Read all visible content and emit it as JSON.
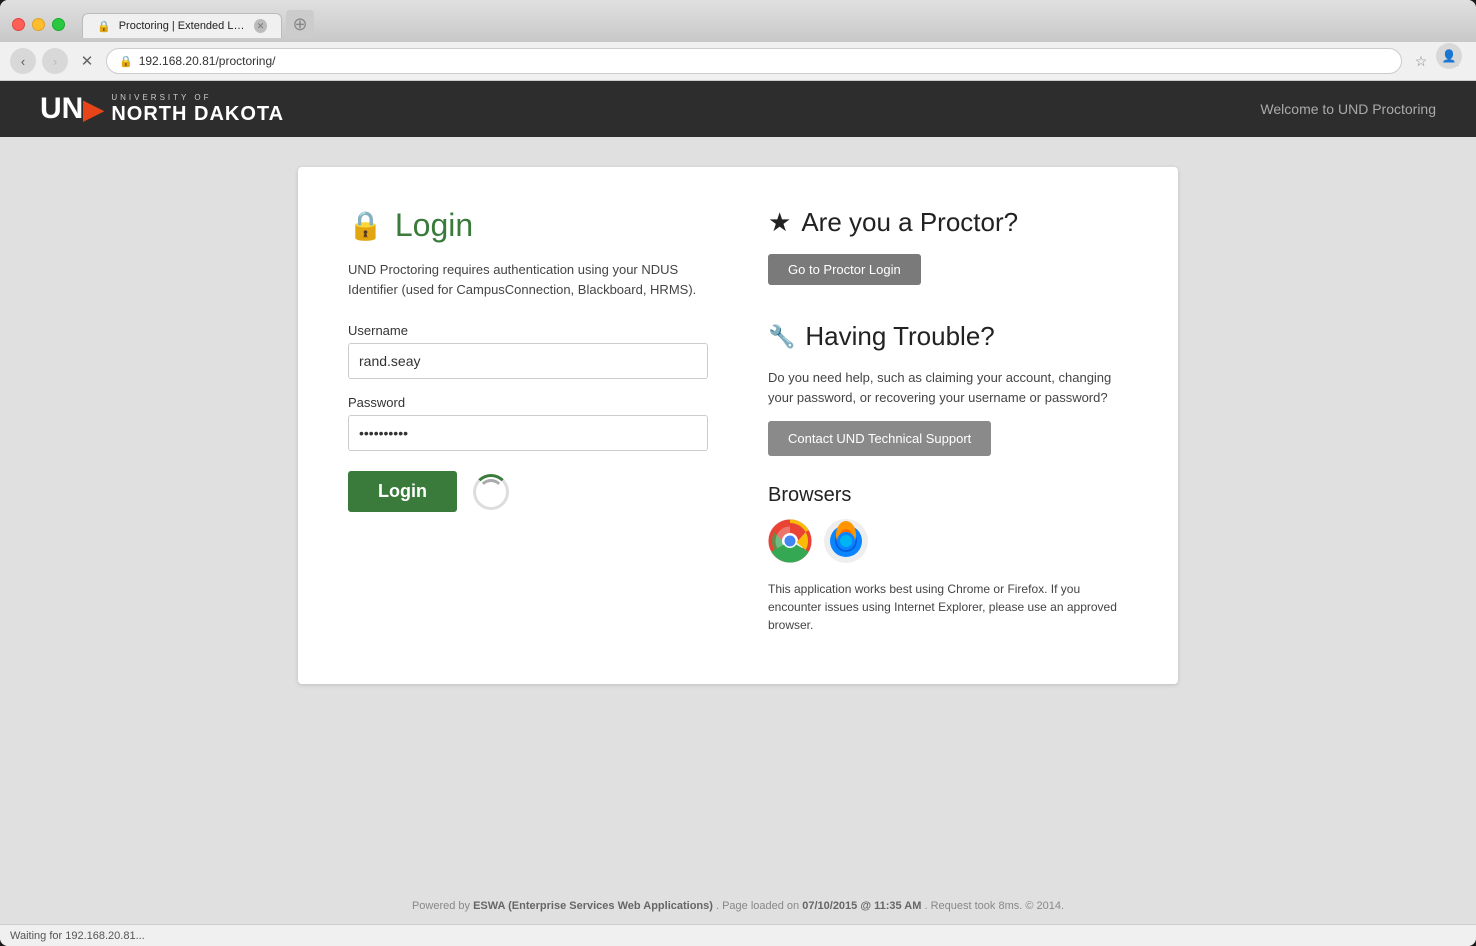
{
  "browser": {
    "tab_title": "Proctoring | Extended Lea…",
    "url": "192.168.20.81/proctoring/",
    "profile_icon": "👤"
  },
  "header": {
    "logo_university_of": "UNIVERSITY OF",
    "logo_north_dakota": "NORTH DAKOTA",
    "welcome_text": "Welcome to UND Proctoring"
  },
  "login": {
    "heading": "Login",
    "description": "UND Proctoring requires authentication using your NDUS Identifier (used for CampusConnection, Blackboard, HRMS).",
    "username_label": "Username",
    "username_value": "rand.seay",
    "password_label": "Password",
    "password_value": "••••••••••",
    "login_button": "Login"
  },
  "proctor": {
    "heading": "Are you a Proctor?",
    "button_label": "Go to Proctor Login"
  },
  "trouble": {
    "heading": "Having Trouble?",
    "description": "Do you need help, such as claiming your account, changing your password, or recovering your username or password?",
    "button_label": "Contact UND Technical Support"
  },
  "browsers": {
    "title": "Browsers",
    "description": "This application works best using Chrome or Firefox. If you encounter issues using Internet Explorer, please use an approved browser."
  },
  "footer": {
    "powered_by": "Powered by",
    "eswa": "ESWA (Enterprise Services Web Applications)",
    "page_loaded": ". Page loaded on",
    "date": "07/10/2015 @ 11:35 AM",
    "request": ". Request took 8ms. © 2014."
  },
  "status_bar": {
    "text": "Waiting for 192.168.20.81..."
  }
}
